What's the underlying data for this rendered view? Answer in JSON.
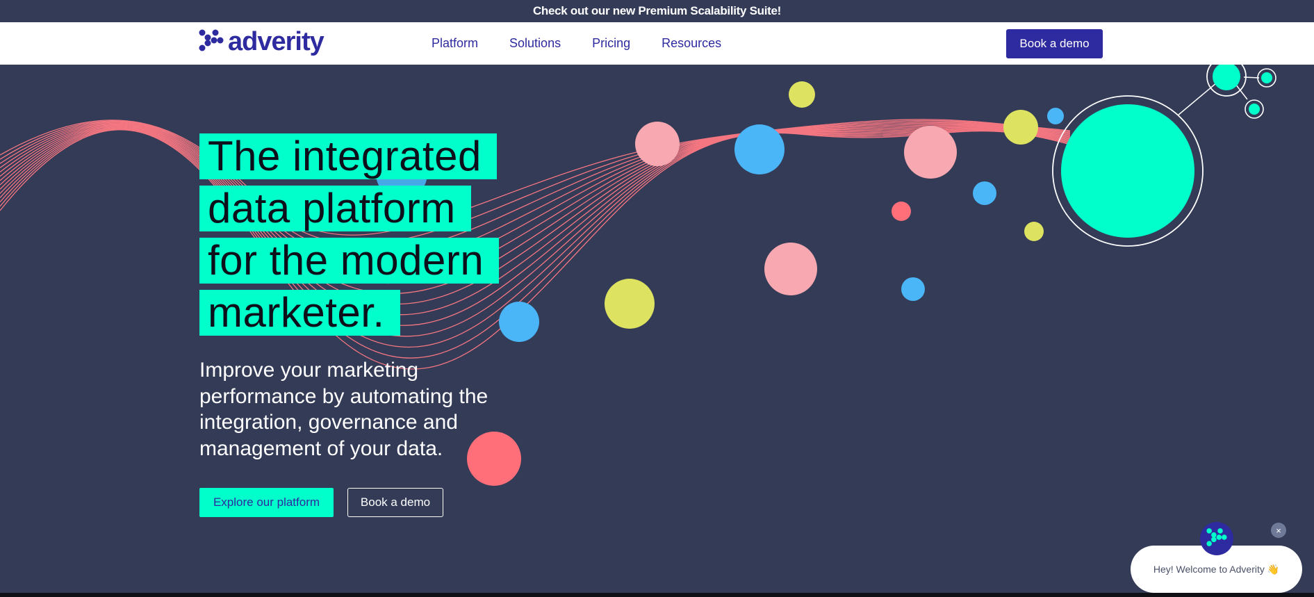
{
  "announcement": {
    "text": "Check out our new Premium Scalability Suite!"
  },
  "nav": {
    "logo_text": "adverity",
    "links": [
      "Platform",
      "Solutions",
      "Pricing",
      "Resources"
    ],
    "cta_label": "Book a demo"
  },
  "hero": {
    "headline_lines": [
      "The integrated",
      "data platform",
      "for the modern",
      "marketer."
    ],
    "subtext": "Improve your marketing performance by automating the integration, governance and management of your data.",
    "primary_button": "Explore our platform",
    "secondary_button": "Book a demo"
  },
  "chat": {
    "message": "Hey! Welcome to Adverity 👋",
    "close_symbol": "×"
  },
  "colors": {
    "background": "#333b57",
    "accent_mint": "#00ffca",
    "brand_indigo": "#2e2a9f",
    "coral": "#ff6f7a",
    "pink": "#f7a8b0",
    "sky_blue": "#4ab5f7",
    "lime": "#dde261"
  },
  "icons": {
    "logo": "adverity-x-logo-icon",
    "chat_avatar": "adverity-x-logo-icon",
    "chat_close": "close-icon"
  }
}
